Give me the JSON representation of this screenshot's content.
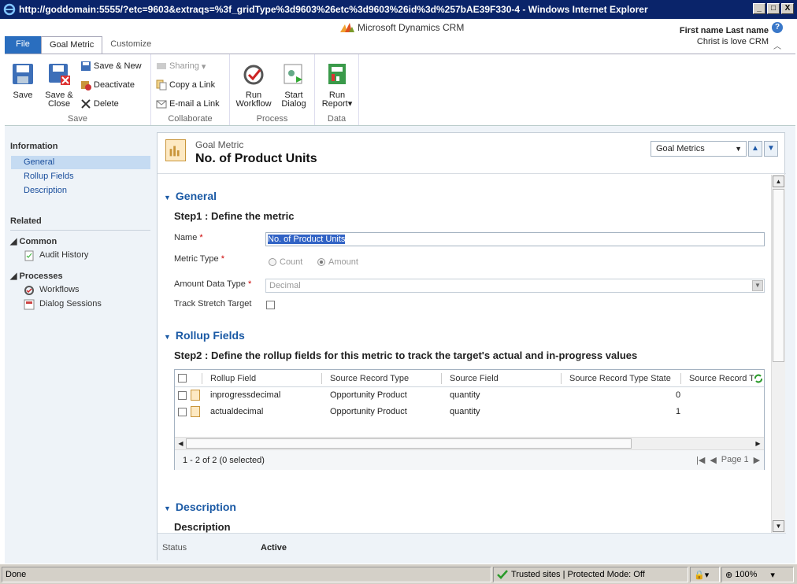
{
  "window": {
    "title": "http://goddomain:5555/?etc=9603&extraqs=%3f_gridType%3d9603%26etc%3d9603%26id%3d%257bAE39F330-4 - Windows Internet Explorer",
    "min": "_",
    "max": "□",
    "close": "X"
  },
  "brand": {
    "name": "Microsoft Dynamics CRM"
  },
  "user": {
    "name": "First name Last name",
    "org": "Christ is love CRM",
    "help": "?"
  },
  "tabs": [
    {
      "label": "File"
    },
    {
      "label": "Goal Metric"
    },
    {
      "label": "Customize"
    }
  ],
  "ribbon": {
    "save_group": {
      "label": "Save",
      "save": "Save",
      "save_close": [
        "Save &",
        "Close"
      ],
      "save_new": "Save & New",
      "deactivate": "Deactivate",
      "delete": "Delete"
    },
    "collab_group": {
      "label": "Collaborate",
      "sharing": "Sharing",
      "copy_link": "Copy a Link",
      "email_link": "E-mail a Link"
    },
    "process_group": {
      "label": "Process",
      "run_workflow": [
        "Run",
        "Workflow"
      ],
      "start_dialog": [
        "Start",
        "Dialog"
      ]
    },
    "data_group": {
      "label": "Data",
      "run_report": [
        "Run",
        "Report"
      ]
    }
  },
  "nav": {
    "information": "Information",
    "items": [
      "General",
      "Rollup Fields",
      "Description"
    ],
    "related": "Related",
    "common": "Common",
    "audit_history": "Audit History",
    "processes": "Processes",
    "workflows": "Workflows",
    "dialog_sessions": "Dialog Sessions"
  },
  "record": {
    "entity_type": "Goal Metric",
    "name": "No. of Product Units",
    "view_selector": "Goal Metrics"
  },
  "general": {
    "section_title": "General",
    "step1": "Step1 : Define the metric",
    "name_label": "Name",
    "name_value": "No. of Product Units",
    "metric_type_label": "Metric Type",
    "metric_type_options": [
      "Count",
      "Amount"
    ],
    "metric_type_selected": "Amount",
    "amount_data_type_label": "Amount Data Type",
    "amount_data_type_value": "Decimal",
    "track_stretch_label": "Track Stretch Target",
    "required_marker": "*"
  },
  "rollup": {
    "section_title": "Rollup Fields",
    "step2": "Step2 : Define the rollup fields for this metric to track the target's actual and in-progress values",
    "columns": [
      "Rollup Field",
      "Source Record Type",
      "Source Field",
      "Source Record Type State",
      "Source Record T"
    ],
    "rows": [
      {
        "field": "inprogressdecimal",
        "type": "Opportunity Product",
        "source_field": "quantity",
        "state": "0"
      },
      {
        "field": "actualdecimal",
        "type": "Opportunity Product",
        "source_field": "quantity",
        "state": "1"
      }
    ],
    "footer": "1 - 2 of 2 (0 selected)",
    "page": "Page 1"
  },
  "description": {
    "section_title": "Description",
    "subtitle": "Description"
  },
  "status": {
    "label": "Status",
    "value": "Active"
  },
  "ie_status": {
    "done": "Done",
    "zone": "Trusted sites | Protected Mode: Off",
    "zoom": "100%"
  }
}
